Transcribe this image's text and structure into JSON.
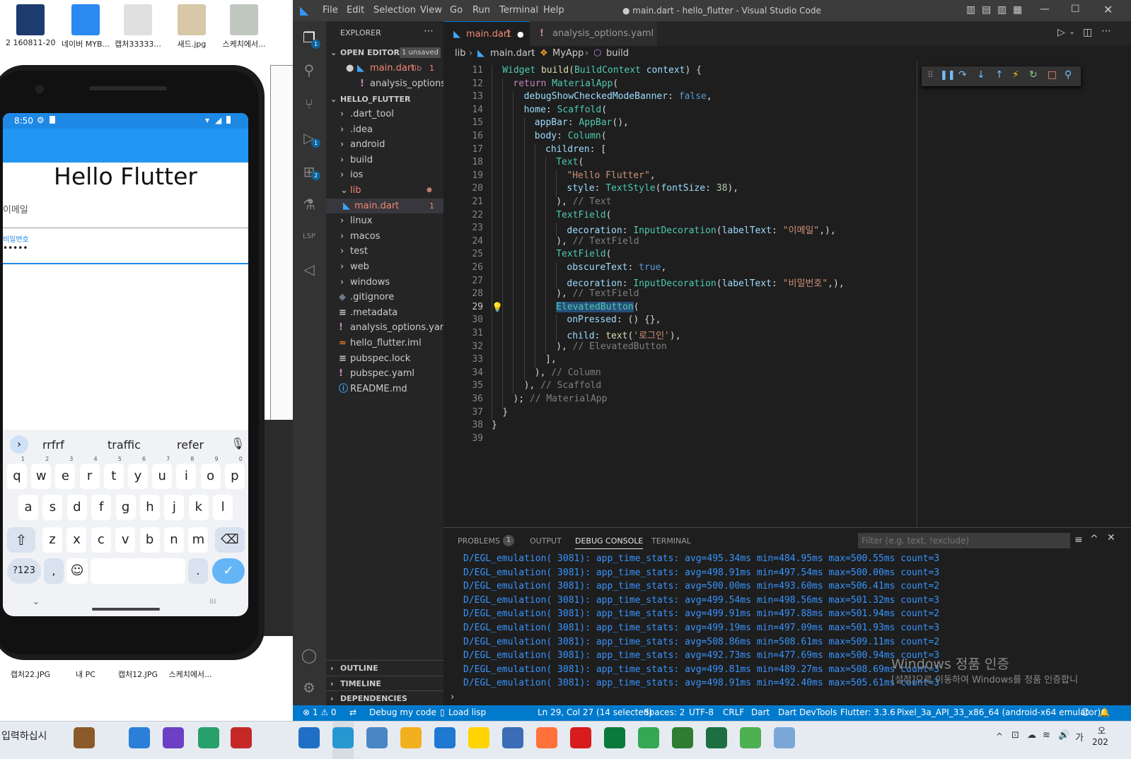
{
  "desktop": {
    "icons_top": [
      "2 160811-20...",
      "네이버 MYB...",
      "캡처33333...",
      "새드.jpg",
      "스케치에서..."
    ],
    "icons_bottom": [
      "캡처22.JPG",
      "내 PC",
      "캡처12.JPG",
      "스케치에서..."
    ]
  },
  "phone": {
    "time": "8:50",
    "title": "Hello Flutter",
    "email_label": "이메일",
    "password_label": "비밀번호",
    "password_value": "•••••",
    "suggestions": [
      "rrfrf",
      "traffic",
      "refer"
    ],
    "row1": [
      [
        "q",
        "1"
      ],
      [
        "w",
        "2"
      ],
      [
        "e",
        "3"
      ],
      [
        "r",
        "4"
      ],
      [
        "t",
        "5"
      ],
      [
        "y",
        "6"
      ],
      [
        "u",
        "7"
      ],
      [
        "i",
        "8"
      ],
      [
        "o",
        "9"
      ],
      [
        "p",
        "0"
      ]
    ],
    "row2": [
      "a",
      "s",
      "d",
      "f",
      "g",
      "h",
      "j",
      "k",
      "l"
    ],
    "row3": [
      "z",
      "x",
      "c",
      "v",
      "b",
      "n",
      "m"
    ],
    "sym_key": "?123",
    "comma": ",",
    "period": "."
  },
  "vscode": {
    "window_title": "● main.dart - hello_flutter - Visual Studio Code",
    "menu": [
      "File",
      "Edit",
      "Selection",
      "View",
      "Go",
      "Run",
      "Terminal",
      "Help"
    ],
    "activity_badges": {
      "explorer": "1",
      "debug": "1",
      "extensions": "2"
    },
    "sidebar": {
      "title": "EXPLORER",
      "open_editors": "OPEN EDITORS",
      "unsaved": "1 unsaved",
      "open_files": [
        {
          "name": "main.dart",
          "desc": "lib",
          "badge": "1"
        },
        {
          "name": "analysis_options...."
        }
      ],
      "project": "HELLO_FLUTTER",
      "tree": [
        ".dart_tool",
        ".idea",
        "android",
        "build",
        "ios",
        "lib",
        "main.dart",
        "linux",
        "macos",
        "test",
        "web",
        "windows",
        ".gitignore",
        ".metadata",
        "analysis_options.yaml",
        "hello_flutter.iml",
        "pubspec.lock",
        "pubspec.yaml",
        "README.md"
      ],
      "main_badge": "1",
      "outline": "OUTLINE",
      "timeline": "TIMELINE",
      "dependencies": "DEPENDENCIES"
    },
    "tabs": [
      {
        "name": "main.dart",
        "badge": "1"
      },
      {
        "name": "analysis_options.yaml"
      }
    ],
    "breadcrumb": [
      "lib",
      "main.dart",
      "MyApp",
      "build"
    ],
    "line_numbers": [
      "11",
      "12",
      "13",
      "14",
      "15",
      "16",
      "17",
      "18",
      "19",
      "20",
      "21",
      "22",
      "23",
      "24",
      "25",
      "26",
      "27",
      "28",
      "29",
      "30",
      "31",
      "32",
      "33",
      "34",
      "35",
      "36",
      "37",
      "38",
      "39"
    ],
    "code": [
      {
        "i": 1,
        "parts": [
          [
            "t",
            "Widget "
          ],
          [
            "f",
            "build"
          ],
          [
            "",
            "("
          ],
          [
            "t",
            "BuildContext "
          ],
          [
            "p",
            "context"
          ],
          [
            "",
            ") {"
          ]
        ]
      },
      {
        "i": 2,
        "parts": [
          [
            "kc",
            "return "
          ],
          [
            "t",
            "MaterialApp"
          ],
          [
            "",
            "("
          ]
        ]
      },
      {
        "i": 3,
        "parts": [
          [
            "p",
            "debugShowCheckedModeBanner"
          ],
          [
            "",
            ": "
          ],
          [
            "k",
            "false"
          ],
          [
            "",
            ","
          ]
        ]
      },
      {
        "i": 3,
        "parts": [
          [
            "p",
            "home"
          ],
          [
            "",
            ": "
          ],
          [
            "t",
            "Scaffold"
          ],
          [
            "",
            "("
          ]
        ]
      },
      {
        "i": 4,
        "parts": [
          [
            "p",
            "appBar"
          ],
          [
            "",
            ": "
          ],
          [
            "t",
            "AppBar"
          ],
          [
            "",
            "(),"
          ]
        ]
      },
      {
        "i": 4,
        "parts": [
          [
            "p",
            "body"
          ],
          [
            "",
            ": "
          ],
          [
            "t",
            "Column"
          ],
          [
            "",
            "("
          ]
        ]
      },
      {
        "i": 5,
        "parts": [
          [
            "p",
            "children"
          ],
          [
            "",
            ": ["
          ]
        ]
      },
      {
        "i": 6,
        "parts": [
          [
            "t",
            "Text"
          ],
          [
            "",
            "("
          ]
        ]
      },
      {
        "i": 7,
        "parts": [
          [
            "s",
            "\"Hello Flutter\""
          ],
          [
            "",
            ","
          ]
        ]
      },
      {
        "i": 7,
        "parts": [
          [
            "p",
            "style"
          ],
          [
            "",
            ": "
          ],
          [
            "t",
            "TextStyle"
          ],
          [
            "",
            "("
          ],
          [
            "p",
            "fontSize"
          ],
          [
            "",
            ": "
          ],
          [
            "n",
            "38"
          ],
          [
            "",
            "),"
          ]
        ]
      },
      {
        "i": 6,
        "parts": [
          [
            "",
            "), "
          ],
          [
            "cm",
            "// Text"
          ]
        ]
      },
      {
        "i": 6,
        "parts": [
          [
            "t",
            "TextField"
          ],
          [
            "",
            "("
          ]
        ]
      },
      {
        "i": 7,
        "parts": [
          [
            "p",
            "decoration"
          ],
          [
            "",
            ": "
          ],
          [
            "t",
            "InputDecoration"
          ],
          [
            "",
            "("
          ],
          [
            "p",
            "labelText"
          ],
          [
            "",
            ": "
          ],
          [
            "s",
            "\"이메일\""
          ],
          [
            "",
            ",),"
          ]
        ]
      },
      {
        "i": 6,
        "parts": [
          [
            "",
            "), "
          ],
          [
            "cm",
            "// TextField"
          ]
        ]
      },
      {
        "i": 6,
        "parts": [
          [
            "t",
            "TextField"
          ],
          [
            "",
            "("
          ]
        ]
      },
      {
        "i": 7,
        "parts": [
          [
            "p",
            "obscureText"
          ],
          [
            "",
            ": "
          ],
          [
            "k",
            "true"
          ],
          [
            "",
            ","
          ]
        ]
      },
      {
        "i": 7,
        "parts": [
          [
            "p",
            "decoration"
          ],
          [
            "",
            ": "
          ],
          [
            "t",
            "InputDecoration"
          ],
          [
            "",
            "("
          ],
          [
            "p",
            "labelText"
          ],
          [
            "",
            ": "
          ],
          [
            "s",
            "\"비밀번호\""
          ],
          [
            "",
            ",),"
          ]
        ]
      },
      {
        "i": 6,
        "parts": [
          [
            "",
            "), "
          ],
          [
            "cm",
            "// TextField"
          ]
        ]
      },
      {
        "i": 6,
        "parts": [
          [
            "t",
            "ElevatedButton"
          ],
          [
            "",
            "("
          ]
        ]
      },
      {
        "i": 7,
        "parts": [
          [
            "p",
            "onPressed"
          ],
          [
            "",
            ": () {},"
          ]
        ]
      },
      {
        "i": 7,
        "parts": [
          [
            "p",
            "child"
          ],
          [
            "",
            ": "
          ],
          [
            "f",
            "text"
          ],
          [
            "",
            "("
          ],
          [
            "s",
            "'로그인'"
          ],
          [
            "",
            "),"
          ]
        ]
      },
      {
        "i": 6,
        "parts": [
          [
            "",
            "), "
          ],
          [
            "cm",
            "// ElevatedButton"
          ]
        ]
      },
      {
        "i": 5,
        "parts": [
          [
            "",
            "],"
          ]
        ]
      },
      {
        "i": 4,
        "parts": [
          [
            "",
            "), "
          ],
          [
            "cm",
            "// Column"
          ]
        ]
      },
      {
        "i": 3,
        "parts": [
          [
            "",
            "), "
          ],
          [
            "cm",
            "// Scaffold"
          ]
        ]
      },
      {
        "i": 2,
        "parts": [
          [
            "",
            "); "
          ],
          [
            "cm",
            "// MaterialApp"
          ]
        ]
      },
      {
        "i": 1,
        "parts": [
          [
            "",
            "}"
          ]
        ]
      },
      {
        "i": 0,
        "parts": [
          [
            "",
            "}"
          ]
        ]
      },
      {
        "i": 0,
        "parts": [
          [
            "",
            ""
          ]
        ]
      }
    ],
    "panel_tabs": [
      "PROBLEMS",
      "OUTPUT",
      "DEBUG CONSOLE",
      "TERMINAL"
    ],
    "problems_count": "1",
    "filter_placeholder": "Filter (e.g. text, !exclude)",
    "log_lines": [
      "D/EGL_emulation( 3081): app_time_stats: avg=495.34ms min=484.95ms max=500.55ms count=3",
      "D/EGL_emulation( 3081): app_time_stats: avg=498.91ms min=497.54ms max=500.00ms count=3",
      "D/EGL_emulation( 3081): app_time_stats: avg=500.00ms min=493.60ms max=506.41ms count=2",
      "D/EGL_emulation( 3081): app_time_stats: avg=499.54ms min=498.56ms max=501.32ms count=3",
      "D/EGL_emulation( 3081): app_time_stats: avg=499.91ms min=497.88ms max=501.94ms count=2",
      "D/EGL_emulation( 3081): app_time_stats: avg=499.19ms min=497.09ms max=501.93ms count=3",
      "D/EGL_emulation( 3081): app_time_stats: avg=508.86ms min=508.61ms max=509.11ms count=2",
      "D/EGL_emulation( 3081): app_time_stats: avg=492.73ms min=477.69ms max=500.94ms count=3",
      "D/EGL_emulation( 3081): app_time_stats: avg=499.81ms min=489.27ms max=508.69ms count=3",
      "D/EGL_emulation( 3081): app_time_stats: avg=498.91ms min=492.40ms max=505.61ms count=3"
    ],
    "watermark1": "Windows 정품 인증",
    "watermark2": "[설정]으로 이동하여 Windows를 정품 인증합니",
    "status": {
      "errors": "1",
      "warnings": "0",
      "debug": "Debug my code",
      "lisp": "Load lisp",
      "position": "Ln 29, Col 27 (14 selected)",
      "spaces": "Spaces: 2",
      "encoding": "UTF-8",
      "eol": "CRLF",
      "lang": "Dart",
      "devtools": "Dart DevTools",
      "flutter": "Flutter: 3.3.6",
      "device": "Pixel_3a_API_33_x86_64 (android-x64 emulator)"
    }
  },
  "taskbar": {
    "input_text": "입력하십시",
    "tray_time": "오",
    "tray_date": "202"
  }
}
